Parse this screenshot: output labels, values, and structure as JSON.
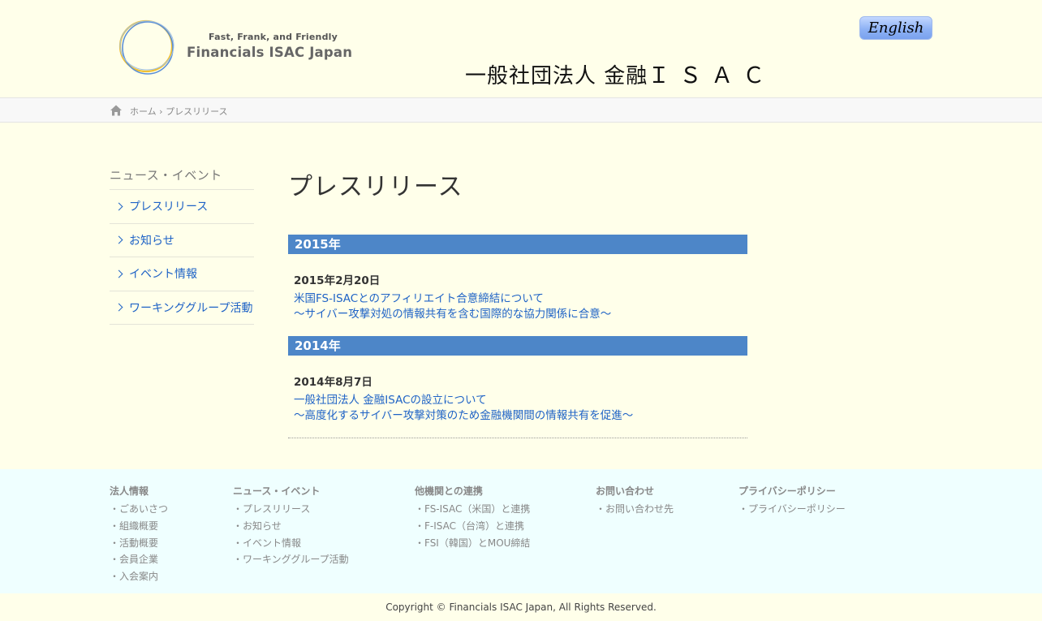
{
  "header": {
    "logo_tagline": "Fast, Frank, and Friendly",
    "logo_name": "Financials ISAC Japan",
    "site_title_main": "一般社団法人  金融",
    "site_title_isac": "ＩＳＡＣ",
    "english_button": "English"
  },
  "breadcrumb": {
    "home": "ホーム",
    "separator": "›",
    "current": "プレスリリース"
  },
  "sidebar": {
    "title": "ニュース・イベント",
    "items": [
      {
        "label": "プレスリリース"
      },
      {
        "label": "お知らせ"
      },
      {
        "label": "イベント情報"
      },
      {
        "label": "ワーキンググループ活動"
      }
    ]
  },
  "main": {
    "page_title": "プレスリリース",
    "sections": [
      {
        "year": "2015年",
        "date": "2015年2月20日",
        "link_line1": "米国FS-ISACとのアフィリエイト合意締結について",
        "link_line2": "～サイバー攻撃対処の情報共有を含む国際的な協力関係に合意～"
      },
      {
        "year": "2014年",
        "date": "2014年8月7日",
        "link_line1": "一般社団法人 金融ISACの設立について",
        "link_line2": "～高度化するサイバー攻撃対策のため金融機関間の情報共有を促進～"
      }
    ]
  },
  "footer": {
    "columns": [
      {
        "title": "法人情報",
        "items": [
          "・ごあいさつ",
          "・組織概要",
          "・活動概要",
          "・会員企業",
          "・入会案内"
        ]
      },
      {
        "title": "ニュース・イベント",
        "items": [
          "・プレスリリース",
          "・お知らせ",
          "・イベント情報",
          "・ワーキンググループ活動"
        ]
      },
      {
        "title": "他機関との連携",
        "items": [
          "・FS-ISAC（米国）と連携",
          "・F-ISAC（台湾）と連携",
          "・FSI（韓国）とMOU締結"
        ]
      },
      {
        "title": "お問い合わせ",
        "items": [
          "・お問い合わせ先"
        ]
      },
      {
        "title": "プライバシーポリシー",
        "items": [
          "・プライバシーポリシー"
        ]
      }
    ],
    "copyright": "Copyright © Financials ISAC Japan, All Rights Reserved."
  },
  "colors": {
    "page_bg": "#ffffea",
    "footer_bg": "#efffff",
    "accent_blue": "#4d86c8",
    "link_blue": "#1f63c6"
  }
}
